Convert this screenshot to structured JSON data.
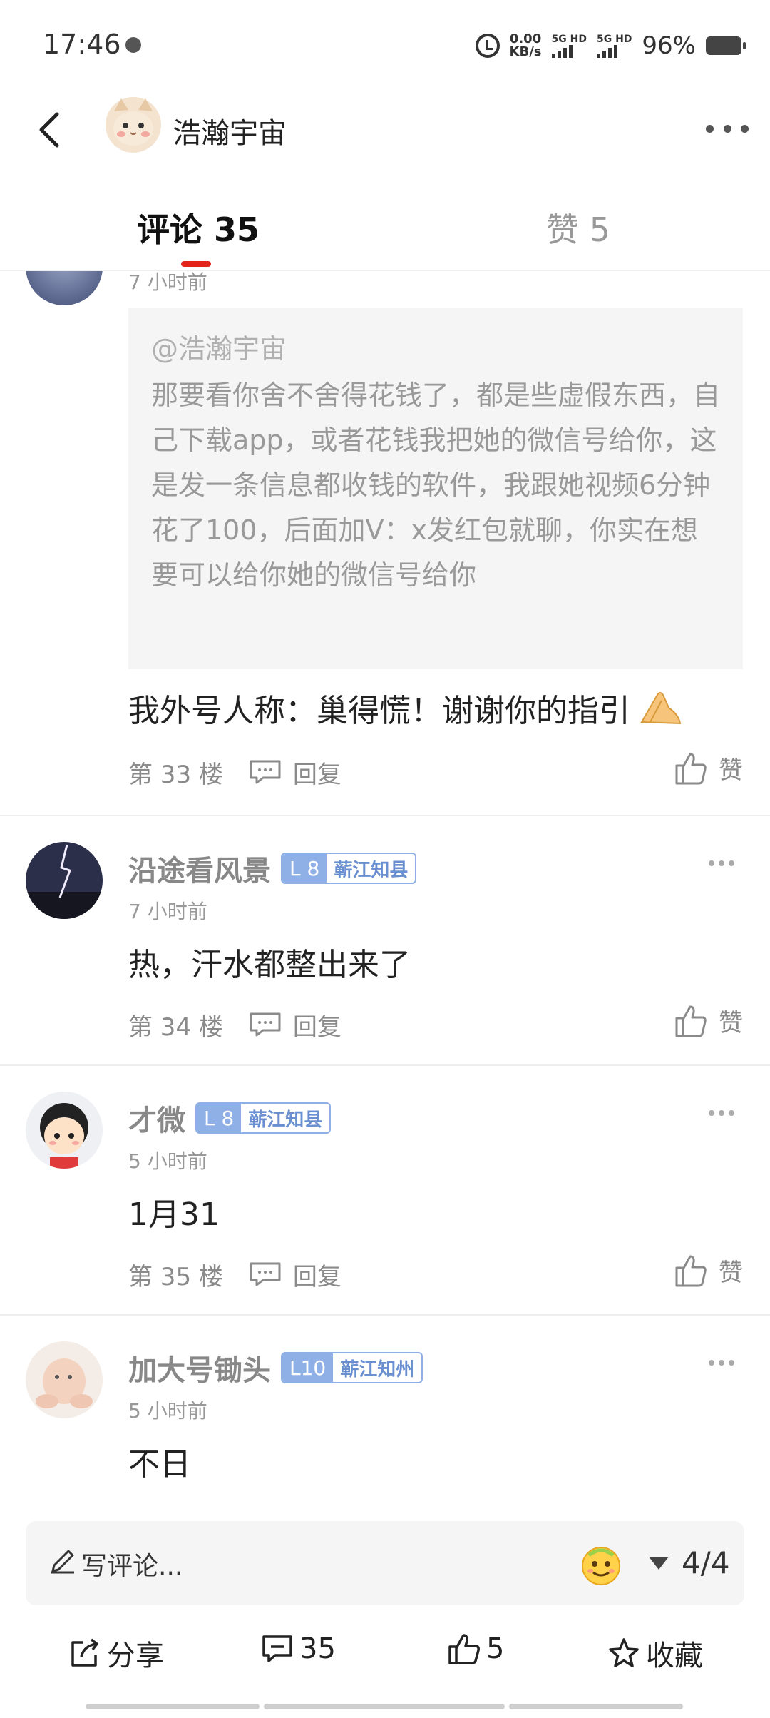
{
  "status_bar": {
    "time": "17:46",
    "net_speed_value": "0.00",
    "net_speed_unit": "KB/s",
    "sim1": "5G HD",
    "sim2": "5G HD",
    "battery": "96%"
  },
  "header": {
    "title": "浩瀚宇宙"
  },
  "tabs": {
    "comments_label": "评论 35",
    "likes_label": "赞 5"
  },
  "thread": {
    "time": "7 小时前",
    "quote_user": "@浩瀚宇宙",
    "quote_text": "那要看你舍不舍得花钱了，都是些虚假东西，自己下载app，或者花钱我把她的微信号给你，这是发一条信息都收钱的软件，我跟她视频6分钟花了100，后面加V：x发红包就聊，你实在想要可以给你她的微信号给你",
    "reply_text": "我外号人称：巢得慌！谢谢你的指引",
    "floor": "第 33 楼",
    "reply_label": "回复",
    "like_label": "赞"
  },
  "comments": [
    {
      "name": "沿途看风景",
      "level": "L 8",
      "level_title": "蕲江知县",
      "time": "7 小时前",
      "text": "热，汗水都整出来了",
      "floor": "第 34 楼",
      "reply_label": "回复",
      "like_label": "赞"
    },
    {
      "name": "才微",
      "level": "L 8",
      "level_title": "蕲江知县",
      "time": "5 小时前",
      "text": "1月31",
      "floor": "第 35 楼",
      "reply_label": "回复",
      "like_label": "赞"
    },
    {
      "name": "加大号锄头",
      "level": "L10",
      "level_title": "蕲江知州",
      "time": "5 小时前",
      "text": "不日"
    }
  ],
  "bottom": {
    "input_placeholder": "写评论...",
    "page_indicator": "4/4",
    "share_label": "分享",
    "comment_count": "35",
    "like_count": "5",
    "favorite_label": "收藏"
  },
  "colors": {
    "accent_red": "#e1251b",
    "level_blue": "#8fb0e6"
  }
}
